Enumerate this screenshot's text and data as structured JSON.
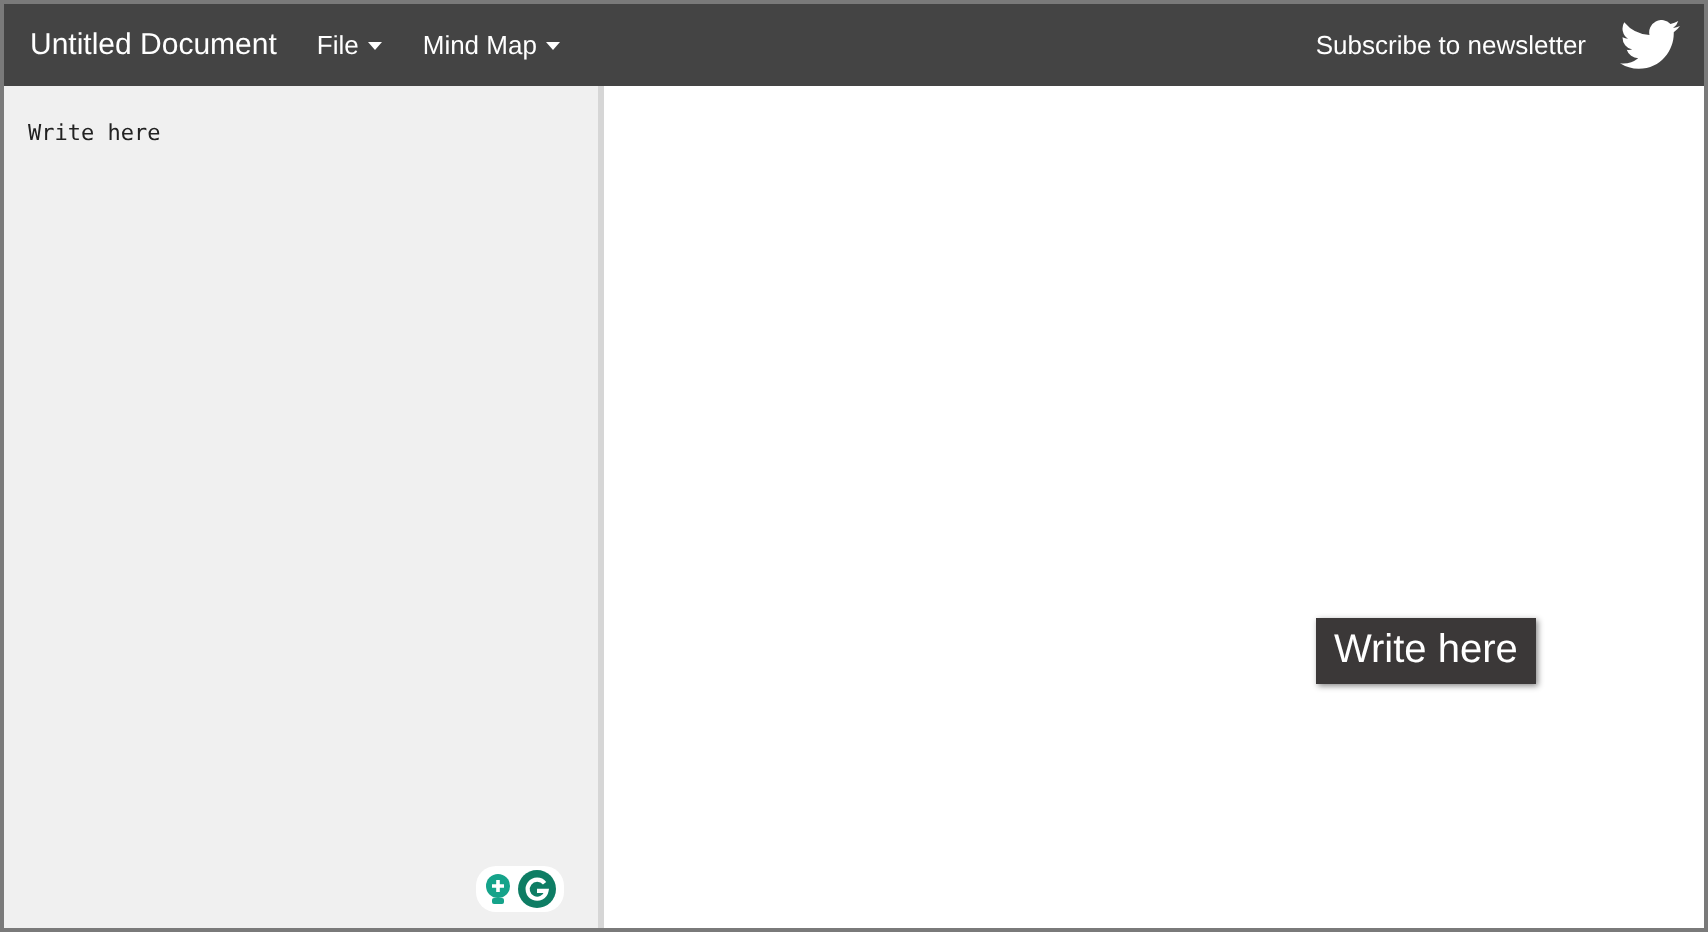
{
  "navbar": {
    "title": "Untitled Document",
    "menus": [
      {
        "label": "File"
      },
      {
        "label": "Mind Map"
      }
    ],
    "subscribe_link": "Subscribe to newsletter"
  },
  "editor": {
    "value": "Write here"
  },
  "mind_map": {
    "nodes": [
      {
        "label": "Write here"
      }
    ]
  }
}
